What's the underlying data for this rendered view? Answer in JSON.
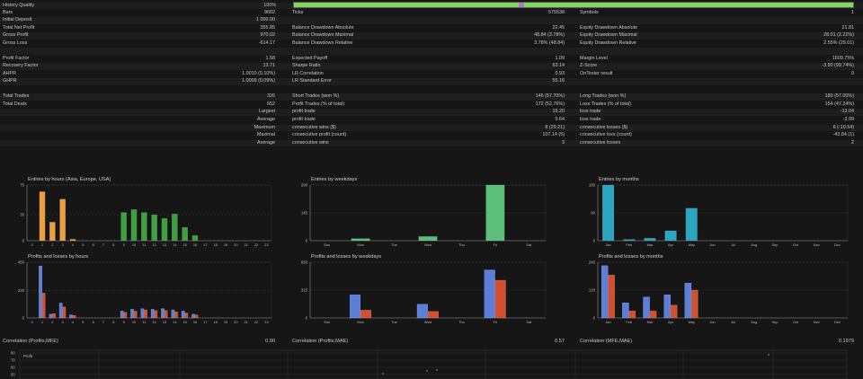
{
  "history_quality": {
    "label": "History Quality",
    "value": "100%",
    "level": 1.0
  },
  "stats_rows": [
    {
      "c": [
        [
          "Bars",
          "9602"
        ],
        [
          "Ticks",
          "575538"
        ],
        [
          "Symbols",
          "1"
        ]
      ]
    },
    {
      "c": [
        [
          "Initial Deposit",
          "1 000.00"
        ],
        [
          "",
          ""
        ],
        [
          "",
          ""
        ]
      ]
    },
    {
      "c": [
        [
          "Total Net Profit",
          "355.85"
        ],
        [
          "Balance Drawdown Absolute",
          "22.45"
        ],
        [
          "Equity Drawdown Absolute",
          "21.81"
        ]
      ]
    },
    {
      "c": [
        [
          "Gross Profit",
          "970.02"
        ],
        [
          "Balance Drawdown Maximal",
          "48.84 (3.78%)"
        ],
        [
          "Equity Drawdown Maximal",
          "28.01 (2.22%)"
        ]
      ]
    },
    {
      "c": [
        [
          "Gross Loss",
          "-614.17"
        ],
        [
          "Balance Drawdown Relative",
          "3.78% (48.84)"
        ],
        [
          "Equity Drawdown Relative",
          "2.55% (29.01)"
        ]
      ]
    },
    {
      "c": [
        [
          "",
          ""
        ],
        [
          "",
          ""
        ],
        [
          "",
          ""
        ]
      ]
    },
    {
      "c": [
        [
          "Profit Factor",
          "1.58"
        ],
        [
          "Expected Payoff",
          "1.09"
        ],
        [
          "Margin Level",
          "1609.75%"
        ]
      ]
    },
    {
      "c": [
        [
          "Recovery Factor",
          "13.71"
        ],
        [
          "Sharpe Ratio",
          "63.14"
        ],
        [
          "Z-Score",
          "-3.90 (99.74%)"
        ]
      ]
    },
    {
      "c": [
        [
          "AHPR",
          "1.0010 (0.10%)"
        ],
        [
          "LR Correlation",
          "0.93"
        ],
        [
          "OnTester result",
          "0"
        ]
      ]
    },
    {
      "c": [
        [
          "GHPR",
          "1.0009 (0.09%)"
        ],
        [
          "LR Standard Error",
          "55.16"
        ],
        [
          "",
          ""
        ]
      ]
    },
    {
      "c": [
        [
          "",
          ""
        ],
        [
          "",
          ""
        ],
        [
          "",
          ""
        ]
      ]
    },
    {
      "c": [
        [
          "Total Trades",
          "326"
        ],
        [
          "Short Trades (won %)",
          "146 (57.70%)"
        ],
        [
          "Long Trades (won %)",
          "180 (57.00%)"
        ]
      ]
    },
    {
      "c": [
        [
          "Total Deals",
          "652"
        ],
        [
          "Profit Trades (% of total)",
          "172 (52.76%)"
        ],
        [
          "Loss Trades (% of total)",
          "154 (47.24%)"
        ]
      ]
    },
    {
      "c": [
        [
          "Largest",
          "",
          true
        ],
        [
          "profit trade",
          "15.20"
        ],
        [
          "loss trade",
          "-13.04"
        ]
      ]
    },
    {
      "c": [
        [
          "Average",
          "",
          true
        ],
        [
          "profit trade",
          "5.64"
        ],
        [
          "loss trade",
          "-3.99"
        ]
      ]
    },
    {
      "c": [
        [
          "Maximum",
          "",
          true
        ],
        [
          "consecutive wins ($)",
          "8 (29.21)"
        ],
        [
          "consecutive losses ($)",
          "6 (-10.54)"
        ]
      ]
    },
    {
      "c": [
        [
          "Maximal",
          "",
          true
        ],
        [
          "consecutive profit (count)",
          "107.14 (5)"
        ],
        [
          "consecutive loss (count)",
          "-43.84 (1)"
        ]
      ]
    },
    {
      "c": [
        [
          "Average",
          "",
          true
        ],
        [
          "consecutive wins",
          "3"
        ],
        [
          "consecutive losses",
          "2"
        ]
      ]
    }
  ],
  "charts": {
    "entries_hours": {
      "title": "Entries by hours (Asia, Europe, USA)"
    },
    "entries_weekdays": {
      "title": "Entries by weekdays"
    },
    "entries_months": {
      "title": "Entries by months"
    },
    "pl_hours": {
      "title": "Profits and losses by hours"
    },
    "pl_weekdays": {
      "title": "Profits and losses by weekdays"
    },
    "pl_months": {
      "title": "Profits and losses by months"
    }
  },
  "correlations": [
    {
      "label": "Correlation (Profits,MFE)",
      "value": "0.90"
    },
    {
      "label": "Correlation (Profits,MAE)",
      "value": "0.57"
    },
    {
      "label": "Correlation (MFE,MAE)",
      "value": "0.1979"
    }
  ],
  "scatter": {
    "series_label": "Profit",
    "y_ticks": [
      "80",
      "70",
      "60",
      "50"
    ]
  },
  "colors": {
    "asia": "#e8a040",
    "europe": "#e8a040",
    "usa": "#3fa040",
    "weekday": "#5cbf7a",
    "month": "#2aa6c0",
    "profit": "#5b7fd8",
    "loss": "#d05030"
  },
  "chart_data": [
    {
      "type": "bar",
      "title": "Entries by hours (Asia, Europe, USA)",
      "categories": [
        "0",
        "1",
        "2",
        "3",
        "4",
        "5",
        "6",
        "7",
        "8",
        "9",
        "10",
        "11",
        "12",
        "13",
        "14",
        "15",
        "16",
        "17",
        "18",
        "19",
        "20",
        "21",
        "22",
        "23"
      ],
      "values": [
        0,
        66,
        25,
        56,
        2,
        0,
        0,
        0,
        0,
        0,
        0,
        0,
        0,
        0,
        0,
        0,
        0,
        0,
        0,
        0,
        0,
        0,
        0,
        0
      ],
      "values_usa": [
        0,
        0,
        0,
        0,
        0,
        0,
        0,
        0,
        0,
        38,
        42,
        38,
        35,
        30,
        36,
        18,
        7,
        0,
        0,
        0,
        0,
        0,
        0,
        0
      ],
      "ylim": [
        0,
        75
      ],
      "y_ticks": [
        "75",
        "35",
        "0"
      ]
    },
    {
      "type": "bar",
      "title": "Entries by weekdays",
      "categories": [
        "Sun",
        "Mon",
        "Tue",
        "Wed",
        "Thu",
        "Fri",
        "Sat"
      ],
      "values": [
        0,
        11,
        0,
        22,
        0,
        290,
        0
      ],
      "ylim": [
        0,
        290
      ],
      "y_ticks": [
        "290",
        "145",
        "0"
      ]
    },
    {
      "type": "bar",
      "title": "Entries by months",
      "categories": [
        "Jan",
        "Feb",
        "Mar",
        "Apr",
        "May",
        "Jun",
        "Jul",
        "Aug",
        "Sep",
        "Oct",
        "Nov",
        "Dec"
      ],
      "values": [
        180,
        4,
        8,
        32,
        105,
        0,
        0,
        0,
        0,
        0,
        0,
        0
      ],
      "ylim": [
        0,
        180
      ],
      "y_ticks": [
        "180",
        "90",
        "0"
      ]
    },
    {
      "type": "bar",
      "title": "Profits and losses by hours",
      "categories": [
        "0",
        "1",
        "2",
        "3",
        "4",
        "5",
        "6",
        "7",
        "8",
        "9",
        "10",
        "11",
        "12",
        "13",
        "14",
        "15",
        "16",
        "17",
        "18",
        "19",
        "20",
        "21",
        "22",
        "23"
      ],
      "series": [
        {
          "name": "",
          "values": [
            0,
            420,
            30,
            120,
            25,
            0,
            0,
            0,
            0,
            55,
            70,
            75,
            70,
            75,
            65,
            55,
            30,
            0,
            0,
            0,
            0,
            0,
            0,
            0
          ]
        },
        {
          "name": "",
          "values": [
            0,
            200,
            35,
            90,
            20,
            0,
            0,
            0,
            0,
            45,
            55,
            65,
            60,
            60,
            50,
            40,
            25,
            0,
            0,
            0,
            0,
            0,
            0,
            0
          ]
        }
      ],
      "ylim": [
        0,
        450
      ],
      "y_ticks": [
        "450",
        "220",
        "0"
      ]
    },
    {
      "type": "bar",
      "title": "Profits and losses by weekdays",
      "categories": [
        "Sun",
        "Mon",
        "Tue",
        "Wed",
        "Thu",
        "Fri",
        "Sat"
      ],
      "series": [
        {
          "name": "",
          "values": [
            0,
            270,
            0,
            160,
            0,
            560,
            0
          ]
        },
        {
          "name": "",
          "values": [
            0,
            90,
            0,
            75,
            0,
            440,
            0
          ]
        }
      ],
      "ylim": [
        0,
        650
      ],
      "y_ticks": [
        "650",
        "325",
        "0"
      ]
    },
    {
      "type": "bar",
      "title": "Profits and losses by months",
      "categories": [
        "Jan",
        "Feb",
        "Mar",
        "Apr",
        "May",
        "Jun",
        "Jul",
        "Aug",
        "Sep",
        "Oct",
        "Nov",
        "Dec"
      ],
      "series": [
        {
          "name": "",
          "values": [
            225,
            65,
            90,
            100,
            150,
            0,
            0,
            0,
            0,
            0,
            0,
            0
          ]
        },
        {
          "name": "",
          "values": [
            185,
            30,
            30,
            55,
            120,
            0,
            0,
            0,
            0,
            0,
            0,
            0
          ]
        }
      ],
      "ylim": [
        0,
        240
      ],
      "y_ticks": [
        "240",
        "120",
        "0"
      ]
    }
  ]
}
